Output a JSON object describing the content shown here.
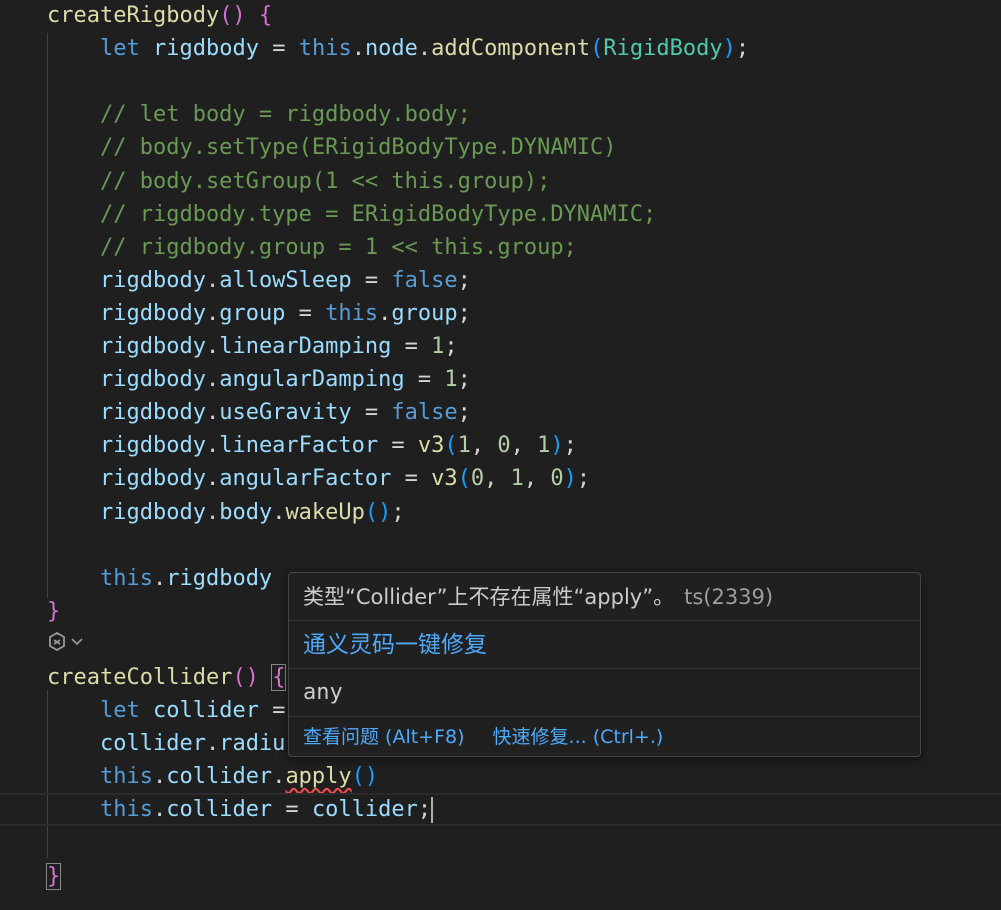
{
  "editor": {
    "lines": [
      {
        "tokens": [
          {
            "t": "createRigbody",
            "c": "fn"
          },
          {
            "t": "() ",
            "c": "p1"
          },
          {
            "t": "{",
            "c": "p1"
          }
        ]
      },
      {
        "tokens": [
          {
            "t": "    ",
            "c": "op"
          },
          {
            "t": "let",
            "c": "kw"
          },
          {
            "t": " ",
            "c": "op"
          },
          {
            "t": "rigdbody",
            "c": "var"
          },
          {
            "t": " = ",
            "c": "op"
          },
          {
            "t": "this",
            "c": "kw"
          },
          {
            "t": ".",
            "c": "op"
          },
          {
            "t": "node",
            "c": "var"
          },
          {
            "t": ".",
            "c": "op"
          },
          {
            "t": "addComponent",
            "c": "fn"
          },
          {
            "t": "(",
            "c": "p2"
          },
          {
            "t": "RigidBody",
            "c": "cls"
          },
          {
            "t": ")",
            "c": "p2"
          },
          {
            "t": ";",
            "c": "op"
          }
        ]
      },
      {
        "tokens": []
      },
      {
        "tokens": [
          {
            "t": "    // let body = rigdbody.body;",
            "c": "cmt"
          }
        ]
      },
      {
        "tokens": [
          {
            "t": "    // body.setType(ERigidBodyType.DYNAMIC)",
            "c": "cmt"
          }
        ]
      },
      {
        "tokens": [
          {
            "t": "    // body.setGroup(1 << this.group);",
            "c": "cmt"
          }
        ]
      },
      {
        "tokens": [
          {
            "t": "    // rigdbody.type = ERigidBodyType.DYNAMIC;",
            "c": "cmt"
          }
        ]
      },
      {
        "tokens": [
          {
            "t": "    // rigdbody.group = 1 << this.group;",
            "c": "cmt"
          }
        ]
      },
      {
        "tokens": [
          {
            "t": "    ",
            "c": "op"
          },
          {
            "t": "rigdbody",
            "c": "var"
          },
          {
            "t": ".",
            "c": "op"
          },
          {
            "t": "allowSleep",
            "c": "var"
          },
          {
            "t": " = ",
            "c": "op"
          },
          {
            "t": "false",
            "c": "kw"
          },
          {
            "t": ";",
            "c": "op"
          }
        ]
      },
      {
        "tokens": [
          {
            "t": "    ",
            "c": "op"
          },
          {
            "t": "rigdbody",
            "c": "var"
          },
          {
            "t": ".",
            "c": "op"
          },
          {
            "t": "group",
            "c": "var"
          },
          {
            "t": " = ",
            "c": "op"
          },
          {
            "t": "this",
            "c": "kw"
          },
          {
            "t": ".",
            "c": "op"
          },
          {
            "t": "group",
            "c": "var"
          },
          {
            "t": ";",
            "c": "op"
          }
        ]
      },
      {
        "tokens": [
          {
            "t": "    ",
            "c": "op"
          },
          {
            "t": "rigdbody",
            "c": "var"
          },
          {
            "t": ".",
            "c": "op"
          },
          {
            "t": "linearDamping",
            "c": "var"
          },
          {
            "t": " = ",
            "c": "op"
          },
          {
            "t": "1",
            "c": "num"
          },
          {
            "t": ";",
            "c": "op"
          }
        ]
      },
      {
        "tokens": [
          {
            "t": "    ",
            "c": "op"
          },
          {
            "t": "rigdbody",
            "c": "var"
          },
          {
            "t": ".",
            "c": "op"
          },
          {
            "t": "angularDamping",
            "c": "var"
          },
          {
            "t": " = ",
            "c": "op"
          },
          {
            "t": "1",
            "c": "num"
          },
          {
            "t": ";",
            "c": "op"
          }
        ]
      },
      {
        "tokens": [
          {
            "t": "    ",
            "c": "op"
          },
          {
            "t": "rigdbody",
            "c": "var"
          },
          {
            "t": ".",
            "c": "op"
          },
          {
            "t": "useGravity",
            "c": "var"
          },
          {
            "t": " = ",
            "c": "op"
          },
          {
            "t": "false",
            "c": "kw"
          },
          {
            "t": ";",
            "c": "op"
          }
        ]
      },
      {
        "tokens": [
          {
            "t": "    ",
            "c": "op"
          },
          {
            "t": "rigdbody",
            "c": "var"
          },
          {
            "t": ".",
            "c": "op"
          },
          {
            "t": "linearFactor",
            "c": "var"
          },
          {
            "t": " = ",
            "c": "op"
          },
          {
            "t": "v3",
            "c": "fn"
          },
          {
            "t": "(",
            "c": "p2"
          },
          {
            "t": "1",
            "c": "num"
          },
          {
            "t": ", ",
            "c": "op"
          },
          {
            "t": "0",
            "c": "num"
          },
          {
            "t": ", ",
            "c": "op"
          },
          {
            "t": "1",
            "c": "num"
          },
          {
            "t": ")",
            "c": "p2"
          },
          {
            "t": ";",
            "c": "op"
          }
        ]
      },
      {
        "tokens": [
          {
            "t": "    ",
            "c": "op"
          },
          {
            "t": "rigdbody",
            "c": "var"
          },
          {
            "t": ".",
            "c": "op"
          },
          {
            "t": "angularFactor",
            "c": "var"
          },
          {
            "t": " = ",
            "c": "op"
          },
          {
            "t": "v3",
            "c": "fn"
          },
          {
            "t": "(",
            "c": "p2"
          },
          {
            "t": "0",
            "c": "num"
          },
          {
            "t": ", ",
            "c": "op"
          },
          {
            "t": "1",
            "c": "num"
          },
          {
            "t": ", ",
            "c": "op"
          },
          {
            "t": "0",
            "c": "num"
          },
          {
            "t": ")",
            "c": "p2"
          },
          {
            "t": ";",
            "c": "op"
          }
        ]
      },
      {
        "tokens": [
          {
            "t": "    ",
            "c": "op"
          },
          {
            "t": "rigdbody",
            "c": "var"
          },
          {
            "t": ".",
            "c": "op"
          },
          {
            "t": "body",
            "c": "var"
          },
          {
            "t": ".",
            "c": "op"
          },
          {
            "t": "wakeUp",
            "c": "fn"
          },
          {
            "t": "()",
            "c": "p2"
          },
          {
            "t": ";",
            "c": "op"
          }
        ]
      },
      {
        "tokens": []
      },
      {
        "tokens": [
          {
            "t": "    ",
            "c": "op"
          },
          {
            "t": "this",
            "c": "kw"
          },
          {
            "t": ".",
            "c": "op"
          },
          {
            "t": "rigdbody",
            "c": "var"
          }
        ]
      },
      {
        "tokens": [
          {
            "t": "}",
            "c": "p1"
          }
        ]
      },
      {
        "tokens": []
      },
      {
        "tokens": [
          {
            "t": "createCollider",
            "c": "fn"
          },
          {
            "t": "() ",
            "c": "p1"
          },
          {
            "t": "{",
            "c": "p1",
            "hl": true
          }
        ]
      },
      {
        "tokens": [
          {
            "t": "    ",
            "c": "op"
          },
          {
            "t": "let",
            "c": "kw"
          },
          {
            "t": " ",
            "c": "op"
          },
          {
            "t": "collider",
            "c": "var"
          },
          {
            "t": " =",
            "c": "op"
          }
        ]
      },
      {
        "tokens": [
          {
            "t": "    ",
            "c": "op"
          },
          {
            "t": "collider",
            "c": "var"
          },
          {
            "t": ".",
            "c": "op"
          },
          {
            "t": "radiu",
            "c": "var"
          }
        ]
      },
      {
        "tokens": [
          {
            "t": "    ",
            "c": "op"
          },
          {
            "t": "this",
            "c": "kw"
          },
          {
            "t": ".",
            "c": "op"
          },
          {
            "t": "collider",
            "c": "var"
          },
          {
            "t": ".",
            "c": "op"
          },
          {
            "t": "apply",
            "c": "fn",
            "err": true
          },
          {
            "t": "()",
            "c": "p2"
          }
        ]
      },
      {
        "tokens": [
          {
            "t": "    ",
            "c": "op"
          },
          {
            "t": "this",
            "c": "kw"
          },
          {
            "t": ".",
            "c": "op"
          },
          {
            "t": "collider",
            "c": "var"
          },
          {
            "t": " = ",
            "c": "op"
          },
          {
            "t": "collider",
            "c": "var"
          },
          {
            "t": ";",
            "c": "op"
          }
        ],
        "cursor": true,
        "current": true
      },
      {
        "tokens": []
      },
      {
        "tokens": [
          {
            "t": "}",
            "c": "p1",
            "hl": true
          }
        ]
      }
    ]
  },
  "hover": {
    "message": "类型“Collider”上不存在属性“apply”。",
    "code": "ts(2339)",
    "ai_fix": "通义灵码一键修复",
    "type_info": "any",
    "view_problem": "查看问题 (Alt+F8)",
    "quick_fix": "快速修复... (Ctrl+.)"
  },
  "icons": {
    "fold_icon": "tongyi-lingma-icon",
    "chevron": "chevron-down-icon"
  }
}
